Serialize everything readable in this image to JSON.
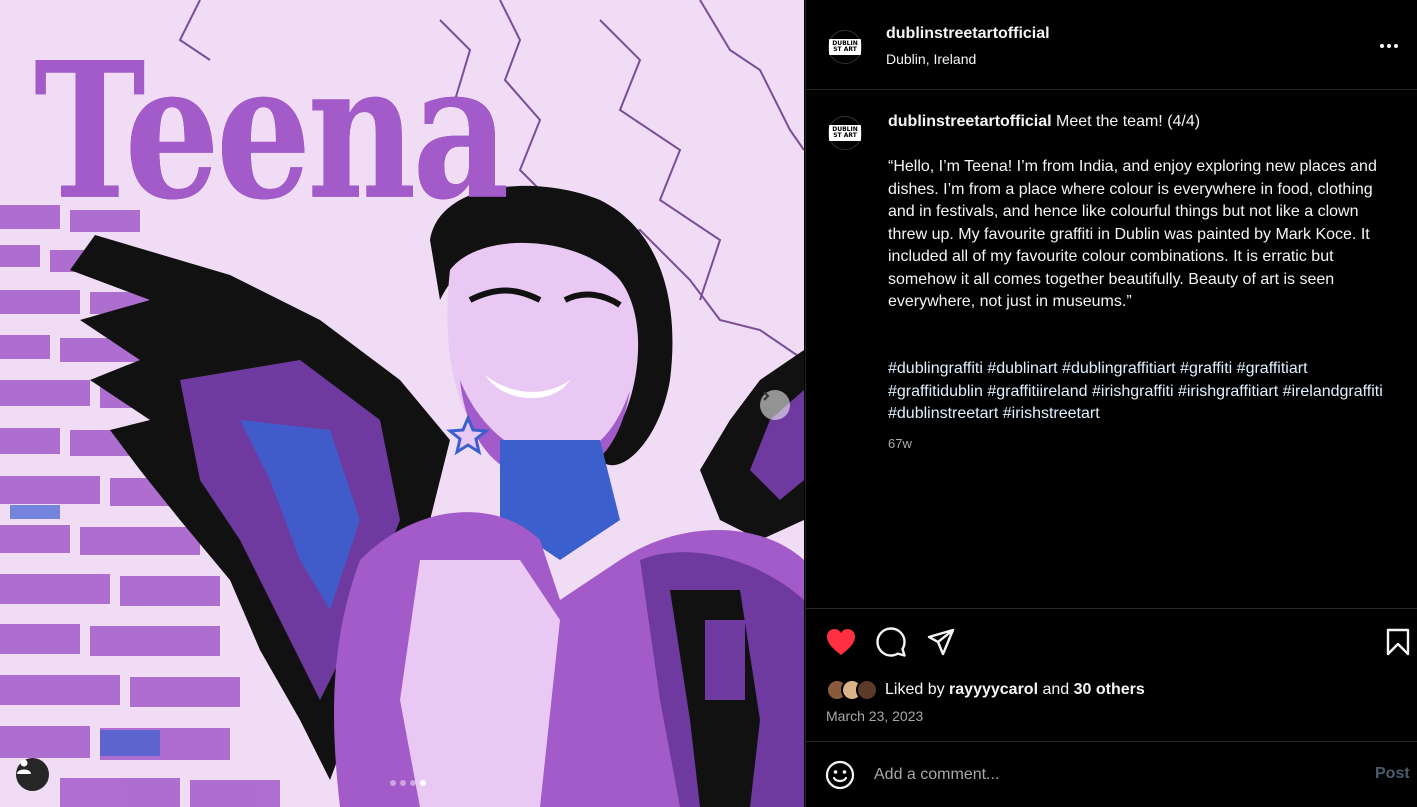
{
  "media": {
    "title_text": "Teena",
    "colors": {
      "bg": "#f1dcf6",
      "brick": "#a35bc9",
      "accent": "#3c5fce",
      "dark": "#111111"
    },
    "carousel": {
      "slide": 4,
      "total": 4
    },
    "icons": {
      "user_tag": "person-icon",
      "next": "chevron-right-icon"
    }
  },
  "header": {
    "username": "dublinstreetartofficial",
    "location": "Dublin, Ireland",
    "avatar_sign": "DUBLIN ST ART"
  },
  "caption": {
    "username": "dublinstreetartofficial",
    "headline": "Meet the team! (4/4)",
    "body": "“Hello, I’m Teena! I’m from India, and enjoy exploring new places and dishes. I’m from a place where colour is everywhere in food, clothing and in festivals, and hence like colourful things but not like a clown threw up. My favourite graffiti in Dublin was painted by Mark Koce. It included all of my favourite colour combinations. It is erratic but somehow it all comes together beautifully. Beauty of art is seen everywhere, not just in museums.”",
    "hashtags": "#dublingraffiti #dublinart #dublingraffitiart #graffiti #graffitiart #graffitidublin #graffitiireland #irishgraffiti #irishgraffitiart #irelandgraffiti #dublinstreetart #irishstreetart",
    "age": "67w"
  },
  "actions": {
    "icons": [
      "heart-filled-icon",
      "comment-icon",
      "share-icon",
      "bookmark-icon"
    ],
    "like_color": "#ff3040",
    "liked_by_prefix": "Liked by",
    "liked_by_user": "rayyyycarol",
    "liked_by_and": "and",
    "liked_by_others": "30 others",
    "date": "March 23, 2023"
  },
  "comment": {
    "placeholder": "Add a comment...",
    "post_label": "Post"
  }
}
